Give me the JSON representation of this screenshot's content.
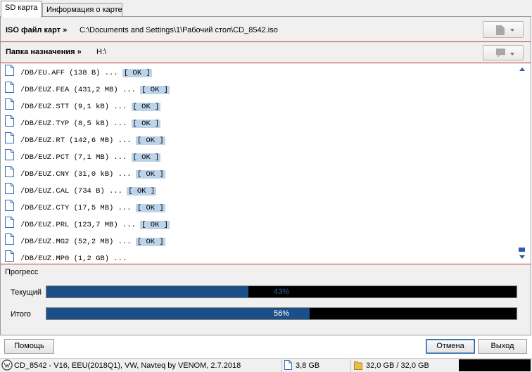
{
  "tabs": [
    {
      "label": "SD карта",
      "active": true
    },
    {
      "label": "Информация о карте",
      "active": false
    }
  ],
  "iso": {
    "label": "ISO файл карт »",
    "value": "C:\\Documents and Settings\\1\\Рабочий стол\\CD_8542.iso"
  },
  "destination": {
    "label": "Папка назначения »",
    "value": "H:\\"
  },
  "log": [
    {
      "text": "/DB/EU.AFF (138 B) ...",
      "status": "[ OK ]"
    },
    {
      "text": "/DB/EUZ.FEA (431,2 MB) ...",
      "status": "[ OK ]"
    },
    {
      "text": "/DB/EUZ.STT (9,1 kB) ...",
      "status": "[ OK ]"
    },
    {
      "text": "/DB/EUZ.TYP (8,5 kB) ...",
      "status": "[ OK ]"
    },
    {
      "text": "/DB/EUZ.RT (142,6 MB) ...",
      "status": "[ OK ]"
    },
    {
      "text": "/DB/EUZ.PCT (7,1 MB) ...",
      "status": "[ OK ]"
    },
    {
      "text": "/DB/EUZ.CNY (31,0 kB) ...",
      "status": "[ OK ]"
    },
    {
      "text": "/DB/EUZ.CAL (734 B) ...",
      "status": "[ OK ]"
    },
    {
      "text": "/DB/EUZ.CTY (17,5 MB) ...",
      "status": "[ OK ]"
    },
    {
      "text": "/DB/EUZ.PRL (123,7 MB) ...",
      "status": "[ OK ]"
    },
    {
      "text": "/DB/EUZ.MG2 (52,2 MB) ...",
      "status": "[ OK ]"
    },
    {
      "text": "/DB/EUZ.MP0 (1,2 GB) ...",
      "status": ""
    }
  ],
  "progress": {
    "title": "Прогресс",
    "current_label": "Текущий",
    "current_text": "43%",
    "current_value": 0.43,
    "total_label": "Итого",
    "total_text": "56%",
    "total_value": 0.56
  },
  "buttons": {
    "help": "Помощь",
    "cancel": "Отмена",
    "exit": "Выход"
  },
  "status": {
    "title": "CD_8542 - V16, EEU(2018Q1), VW, Navteq by VENOM, 2.7.2018",
    "size": "3,8 GB",
    "space": "32,0 GB / 32,0 GB"
  },
  "colors": {
    "accent": "#1c4f87",
    "ok_bg": "#bcd3ea",
    "separator": "#c03030"
  }
}
